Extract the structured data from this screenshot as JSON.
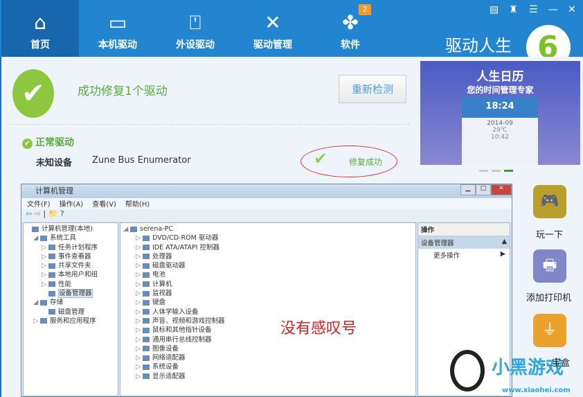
{
  "nav": {
    "tabs": [
      {
        "label": "首页",
        "icon": "home-icon",
        "glyph": "⌂"
      },
      {
        "label": "本机驱动",
        "icon": "monitor-icon",
        "glyph": "▭"
      },
      {
        "label": "外设驱动",
        "icon": "usb-icon",
        "glyph": "⍞"
      },
      {
        "label": "驱动管理",
        "icon": "tools-icon",
        "glyph": "✕"
      },
      {
        "label": "软件",
        "icon": "clover-icon",
        "glyph": "✤",
        "badge": "2"
      }
    ],
    "window_buttons": [
      "feedback",
      "skin",
      "menu",
      "minimize",
      "close"
    ],
    "brand": "驱动人生",
    "brand_logo": "6"
  },
  "result": {
    "title": "成功修复1个驱动",
    "recheck": "重新检测",
    "section": "正常驱动",
    "device_type": "未知设备",
    "device_name": "Zune Bus Enumerator",
    "status": "修复成功"
  },
  "ad": {
    "title": "人生日历",
    "subtitle": "您的时间管理专家",
    "time": "18:24",
    "date": "2014-09",
    "temp": "29℃",
    "time2": "10:42"
  },
  "apps": [
    {
      "label": "玩一下"
    },
    {
      "label": "添加打印机"
    },
    {
      "label": "…宝盒"
    }
  ],
  "cm": {
    "title": "计算机管理",
    "menu": [
      "文件(F)",
      "操作(A)",
      "查看(V)",
      "帮助(H)"
    ],
    "tree": [
      {
        "t": "计算机管理(本地)",
        "l": 0,
        "a": ""
      },
      {
        "t": "系统工具",
        "l": 1,
        "a": "◢"
      },
      {
        "t": "任务计划程序",
        "l": 2,
        "a": "▷"
      },
      {
        "t": "事件查看器",
        "l": 2,
        "a": "▷"
      },
      {
        "t": "共享文件夹",
        "l": 2,
        "a": "▷"
      },
      {
        "t": "本地用户和组",
        "l": 2,
        "a": "▷"
      },
      {
        "t": "性能",
        "l": 2,
        "a": "▷"
      },
      {
        "t": "设备管理器",
        "l": 2,
        "a": "",
        "sel": true
      },
      {
        "t": "存储",
        "l": 1,
        "a": "◢"
      },
      {
        "t": "磁盘管理",
        "l": 2,
        "a": ""
      },
      {
        "t": "服务和应用程序",
        "l": 1,
        "a": "▷"
      }
    ],
    "root": "serena-PC",
    "devices": [
      "DVD/CD-ROM 驱动器",
      "IDE ATA/ATAPI 控制器",
      "处理器",
      "磁盘驱动器",
      "电池",
      "计算机",
      "监视器",
      "键盘",
      "人体学输入设备",
      "声音、视频和游戏控制器",
      "鼠标和其他指针设备",
      "通用串行总线控制器",
      "图像设备",
      "网络适配器",
      "系统设备",
      "显示适配器"
    ],
    "actions_header": "操作",
    "actions_section": "设备管理器",
    "actions_more": "更多操作"
  },
  "annotation": "没有感叹号",
  "watermark": {
    "name": "小黑游戏",
    "url": "www.xiaohei.com"
  }
}
